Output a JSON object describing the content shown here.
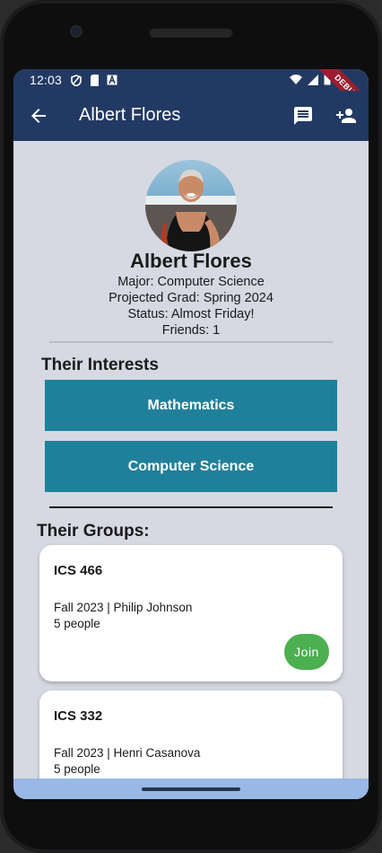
{
  "status_bar": {
    "time": "12:03",
    "icons": [
      "shield-icon",
      "sd-card-icon",
      "a-badge-icon"
    ],
    "right_icons": [
      "wifi-icon",
      "cell-signal-icon",
      "battery-icon"
    ],
    "debug_label": "DEBUG"
  },
  "app_bar": {
    "title": "Albert Flores",
    "back_icon": "arrow-back-icon",
    "message_icon": "message-icon",
    "add_friend_icon": "person-add-icon",
    "color": "#223963"
  },
  "profile": {
    "name": "Albert Flores",
    "major": "Major: Computer Science",
    "grad": "Projected Grad: Spring 2024",
    "status": "Status: Almost Friday!",
    "friends": "Friends: 1"
  },
  "interests": {
    "heading": "Their Interests",
    "items": [
      {
        "label": "Mathematics"
      },
      {
        "label": "Computer Science"
      }
    ],
    "color": "#20809b"
  },
  "groups": {
    "heading": "Their Groups:",
    "items": [
      {
        "title": "ICS 466",
        "term_instructor": "Fall 2023 | Philip Johnson",
        "size": "5 people",
        "action": "Join"
      },
      {
        "title": "ICS 332",
        "term_instructor": "Fall 2023 | Henri Casanova",
        "size": "5 people"
      }
    ],
    "join_color": "#4caf50"
  }
}
